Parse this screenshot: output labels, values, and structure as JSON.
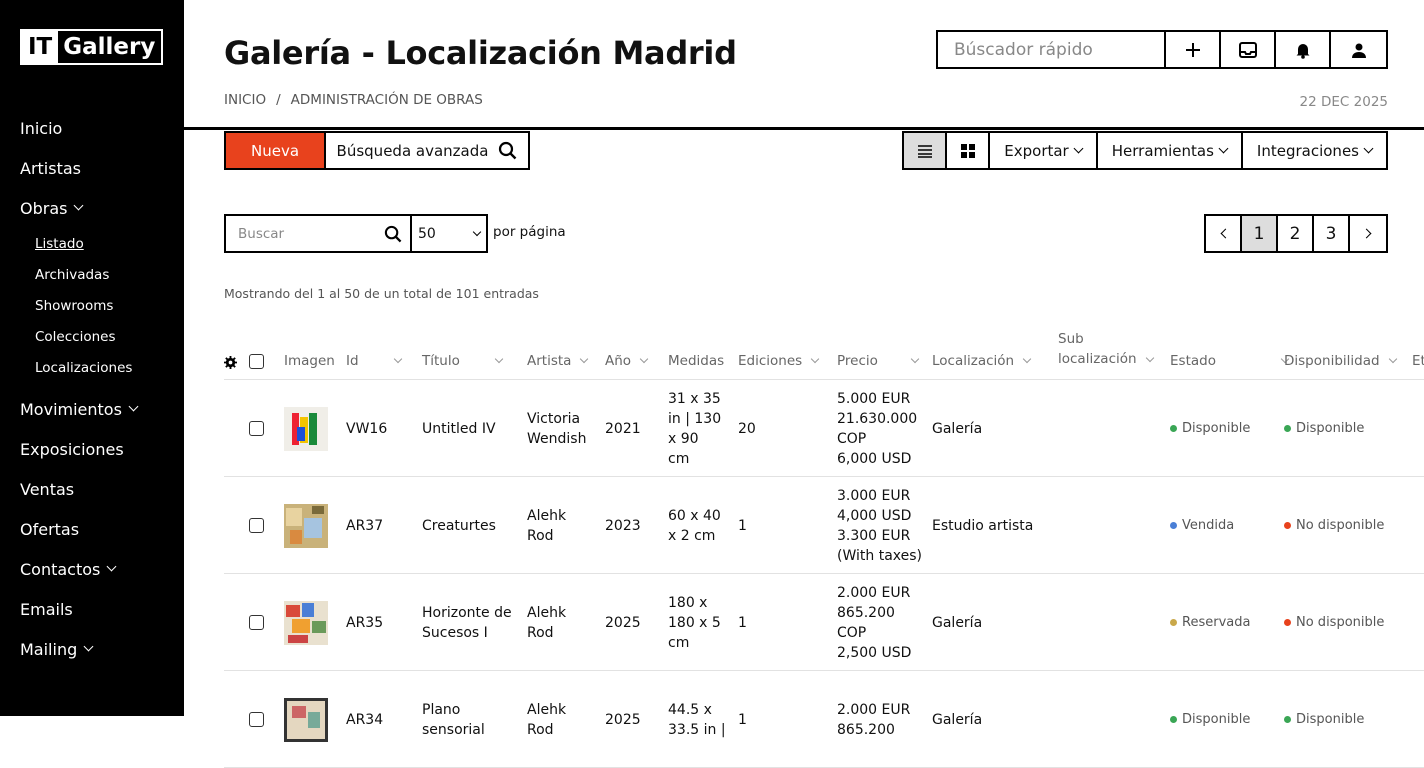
{
  "app": {
    "logo_it": "IT",
    "logo_gallery": "Gallery"
  },
  "sidebar": {
    "items": [
      {
        "label": "Inicio"
      },
      {
        "label": "Artistas"
      },
      {
        "label": "Obras"
      },
      {
        "label": "Movimientos"
      },
      {
        "label": "Exposiciones"
      },
      {
        "label": "Ventas"
      },
      {
        "label": "Ofertas"
      },
      {
        "label": "Contactos"
      },
      {
        "label": "Emails"
      },
      {
        "label": "Mailing"
      }
    ],
    "obras_sub": [
      {
        "label": "Listado"
      },
      {
        "label": "Archivadas"
      },
      {
        "label": "Showrooms"
      },
      {
        "label": "Colecciones"
      },
      {
        "label": "Localizaciones"
      }
    ]
  },
  "header": {
    "title": "Galería - Localización Madrid",
    "breadcrumb": [
      "INICIO",
      "/",
      "ADMINISTRACIÓN DE OBRAS"
    ],
    "date": "22 DEC 2025",
    "quick_search_placeholder": "Búscador rápido"
  },
  "toolbar": {
    "new_label": "Nueva",
    "advanced_search_label": "Búsqueda avanzada",
    "export_label": "Exportar",
    "tools_label": "Herramientas",
    "integrations_label": "Integraciones",
    "accent": "#e8421d"
  },
  "filter": {
    "search_placeholder": "Buscar",
    "per_page_value": "50",
    "per_page_label": "por página",
    "showing": "Mostrando del 1 al 50 de un total de 101 entradas",
    "pages": [
      "1",
      "2",
      "3"
    ]
  },
  "table": {
    "headers": {
      "imagen": "Imagen",
      "id": "Id",
      "titulo": "Título",
      "artista": "Artista",
      "ano": "Año",
      "medidas": "Medidas",
      "ediciones": "Ediciones",
      "precio": "Precio",
      "localizacion": "Localización",
      "sub_loc_1": "Sub",
      "sub_loc_2": "localización",
      "estado": "Estado",
      "disponibilidad": "Disponibilidad",
      "more": "Et"
    },
    "rows": [
      {
        "id": "VW16",
        "titulo": [
          "Untitled IV"
        ],
        "artista": [
          "Victoria",
          "Wendish"
        ],
        "ano": "2021",
        "medidas": [
          "31 x 35",
          "in | 130",
          "x 90",
          "cm"
        ],
        "ediciones": "20",
        "precio": [
          "5.000 EUR",
          "21.630.000",
          "COP",
          "6,000 USD"
        ],
        "localizacion": "Galería",
        "estado": "Disponible",
        "estado_color": "#3aa655",
        "disp": "Disponible",
        "disp_color": "#3aa655"
      },
      {
        "id": "AR37",
        "titulo": [
          "Creaturtes"
        ],
        "artista": [
          "Alehk",
          "Rod"
        ],
        "ano": "2023",
        "medidas": [
          "60 x 40",
          "x 2 cm"
        ],
        "ediciones": "1",
        "precio": [
          "3.000 EUR",
          "4,000 USD",
          "3.300 EUR",
          "(With taxes)"
        ],
        "localizacion": "Estudio artista",
        "estado": "Vendida",
        "estado_color": "#4a7fd6",
        "disp": "No disponible",
        "disp_color": "#e8421d"
      },
      {
        "id": "AR35",
        "titulo": [
          "Horizonte de",
          "Sucesos I"
        ],
        "artista": [
          "Alehk",
          "Rod"
        ],
        "ano": "2025",
        "medidas": [
          "180 x",
          "180 x 5",
          "cm"
        ],
        "ediciones": "1",
        "precio": [
          "2.000 EUR",
          "865.200",
          "COP",
          "2,500 USD"
        ],
        "localizacion": "Galería",
        "estado": "Reservada",
        "estado_color": "#c9a84a",
        "disp": "No disponible",
        "disp_color": "#e8421d"
      },
      {
        "id": "AR34",
        "titulo": [
          "Plano",
          "sensorial"
        ],
        "artista": [
          "Alehk",
          "Rod"
        ],
        "ano": "2025",
        "medidas": [
          "44.5 x",
          "33.5 in |"
        ],
        "ediciones": "1",
        "precio": [
          "2.000 EUR",
          "865.200"
        ],
        "localizacion": "Galería",
        "estado": "Disponible",
        "estado_color": "#3aa655",
        "disp": "Disponible",
        "disp_color": "#3aa655"
      }
    ]
  }
}
